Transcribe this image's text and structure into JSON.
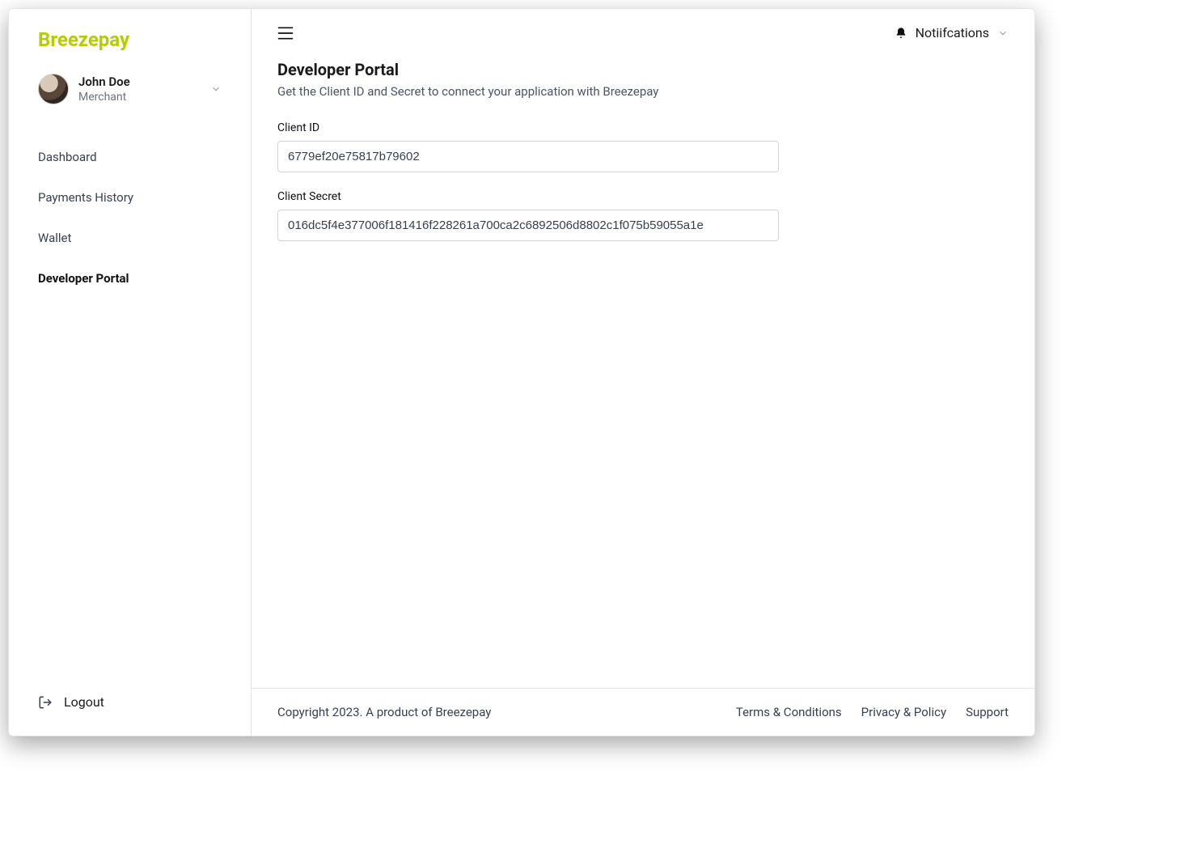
{
  "brand": "Breezepay",
  "user": {
    "name": "John Doe",
    "role": "Merchant"
  },
  "sidebar": {
    "items": [
      {
        "label": "Dashboard"
      },
      {
        "label": "Payments History"
      },
      {
        "label": "Wallet"
      },
      {
        "label": "Developer Portal"
      }
    ],
    "logout": "Logout"
  },
  "topbar": {
    "notifications": "Notiifcations"
  },
  "page": {
    "title": "Developer Portal",
    "subtitle": "Get the Client ID and Secret to connect your application with Breezepay",
    "client_id_label": "Client ID",
    "client_id_value": "6779ef20e75817b79602",
    "client_secret_label": "Client Secret",
    "client_secret_value": "016dc5f4e377006f181416f228261a700ca2c6892506d8802c1f075b59055a1e"
  },
  "footer": {
    "copyright_prefix": "Copyright 2023. A product of ",
    "copyright_brand": "Breezepay",
    "links": [
      {
        "label": "Terms & Conditions"
      },
      {
        "label": "Privacy & Policy"
      },
      {
        "label": "Support"
      }
    ]
  }
}
